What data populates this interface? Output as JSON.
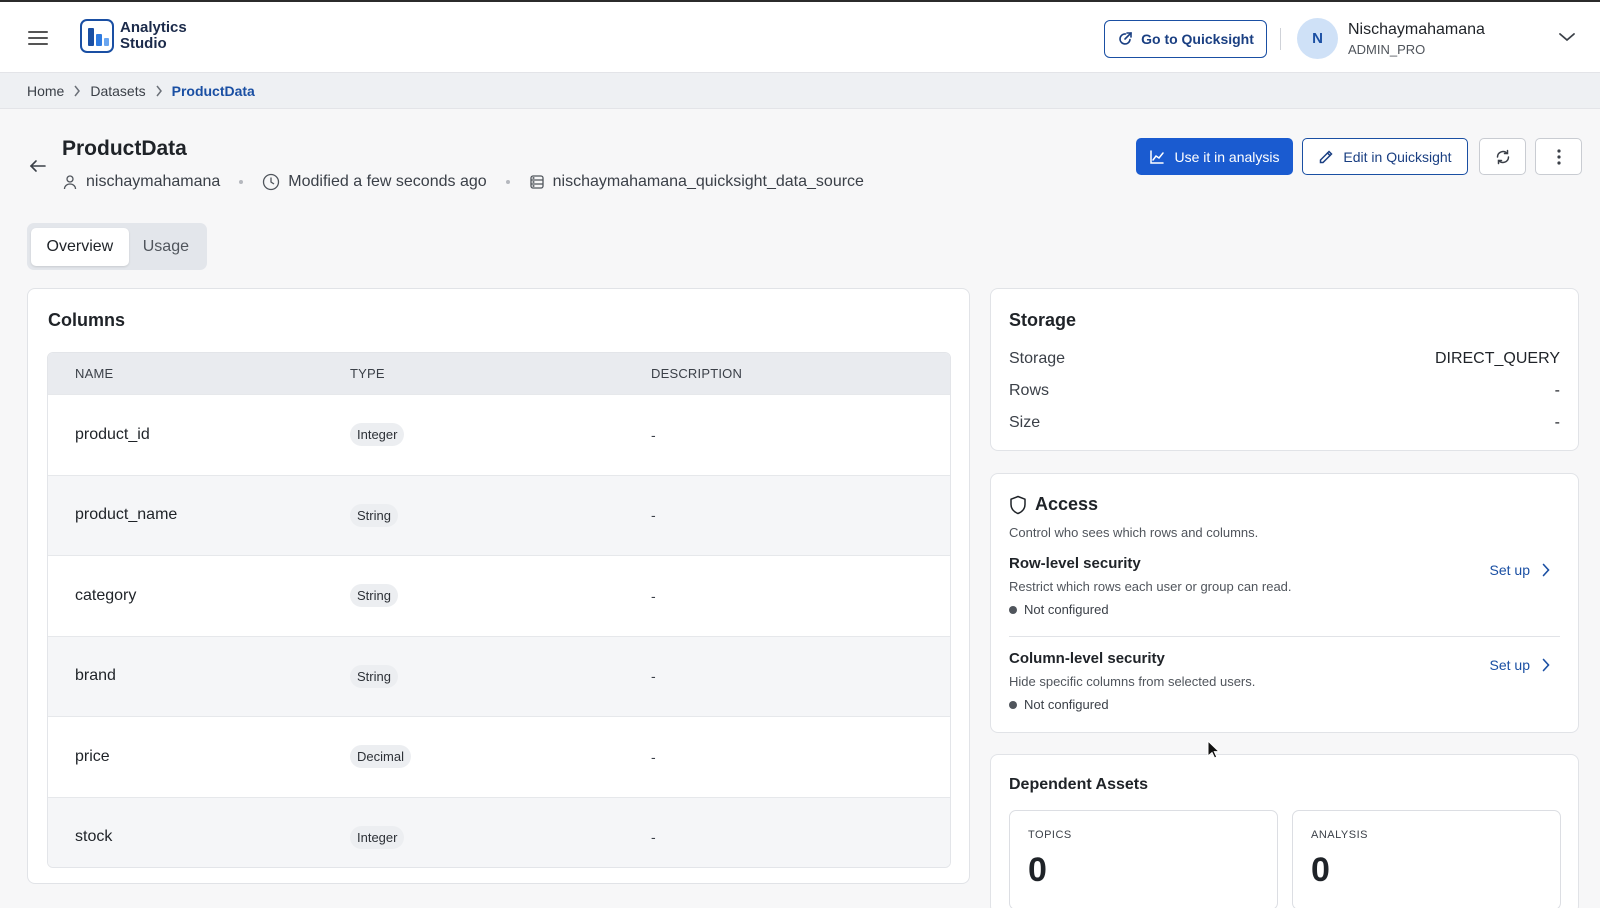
{
  "app": {
    "logo_line1": "Analytics",
    "logo_line2": "Studio"
  },
  "header": {
    "quicksight_button": "Go to Quicksight",
    "avatar_initial": "N",
    "user_name": "Nischaymahamana",
    "user_role": "ADMIN_PRO"
  },
  "breadcrumb": {
    "items": [
      "Home",
      "Datasets",
      "ProductData"
    ]
  },
  "page": {
    "title": "ProductData",
    "owner": "nischaymahamana",
    "modified": "Modified a few seconds ago",
    "data_source": "nischaymahamana_quicksight_data_source"
  },
  "actions": {
    "use_in_analysis": "Use it in analysis",
    "edit_in_quicksight": "Edit in Quicksight"
  },
  "tabs": [
    {
      "label": "Overview",
      "active": true
    },
    {
      "label": "Usage",
      "active": false
    }
  ],
  "columns": {
    "title": "Columns",
    "headers": [
      "NAME",
      "TYPE",
      "DESCRIPTION"
    ],
    "rows": [
      {
        "name": "product_id",
        "type": "Integer",
        "description": "-"
      },
      {
        "name": "product_name",
        "type": "String",
        "description": "-"
      },
      {
        "name": "category",
        "type": "String",
        "description": "-"
      },
      {
        "name": "brand",
        "type": "String",
        "description": "-"
      },
      {
        "name": "price",
        "type": "Decimal",
        "description": "-"
      },
      {
        "name": "stock",
        "type": "Integer",
        "description": "-"
      }
    ]
  },
  "storage": {
    "title": "Storage",
    "rows": [
      {
        "label": "Storage",
        "value": "DIRECT_QUERY"
      },
      {
        "label": "Rows",
        "value": "-"
      },
      {
        "label": "Size",
        "value": "-"
      }
    ]
  },
  "access": {
    "title": "Access",
    "subtitle": "Control who sees which rows and columns.",
    "row_level": {
      "title": "Row-level security",
      "desc": "Restrict which rows each user or group can read.",
      "status": "Not configured",
      "action": "Set up"
    },
    "column_level": {
      "title": "Column-level security",
      "desc": "Hide specific columns from selected users.",
      "status": "Not configured",
      "action": "Set up"
    }
  },
  "dependent_assets": {
    "title": "Dependent Assets",
    "topics": {
      "label": "TOPICS",
      "value": "0"
    },
    "analysis": {
      "label": "ANALYSIS",
      "value": "0"
    }
  },
  "colors": {
    "primary": "#1a5bd0",
    "brand": "#1a4fa3",
    "page_bg": "#f7f7f8"
  },
  "icons": [
    "hamburger-icon",
    "external-link-icon",
    "chevron-down-icon",
    "chevron-right-icon",
    "back-arrow-icon",
    "user-icon",
    "clock-icon",
    "database-icon",
    "chart-line-icon",
    "pencil-icon",
    "refresh-icon",
    "more-vertical-icon",
    "shield-icon"
  ]
}
